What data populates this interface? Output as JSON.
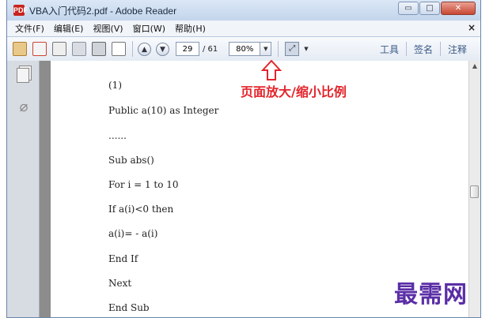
{
  "window": {
    "title": "VBA入门代码2.pdf - Adobe Reader",
    "icon": "PDF",
    "controls": {
      "minimize": "▭",
      "maximize": "□",
      "close": "✕"
    }
  },
  "menu": {
    "items": [
      "文件(F)",
      "编辑(E)",
      "视图(V)",
      "窗口(W)",
      "帮助(H)"
    ],
    "close": "×"
  },
  "toolbar": {
    "current_page": "29",
    "total_pages": "/ 61",
    "zoom": "80%",
    "tools": "工具",
    "sign": "签名",
    "comment": "注释"
  },
  "document": {
    "lines": [
      "(1)",
      "Public a(10) as Integer",
      "......",
      "Sub abs()",
      "For i = 1 to 10",
      "If a(i)<0 then",
      "a(i)= - a(i)",
      "End If",
      "Next",
      "End Sub"
    ]
  },
  "annotation": {
    "text": "页面放大/缩小比例",
    "color": "#e3242b"
  },
  "watermark": "最需网"
}
